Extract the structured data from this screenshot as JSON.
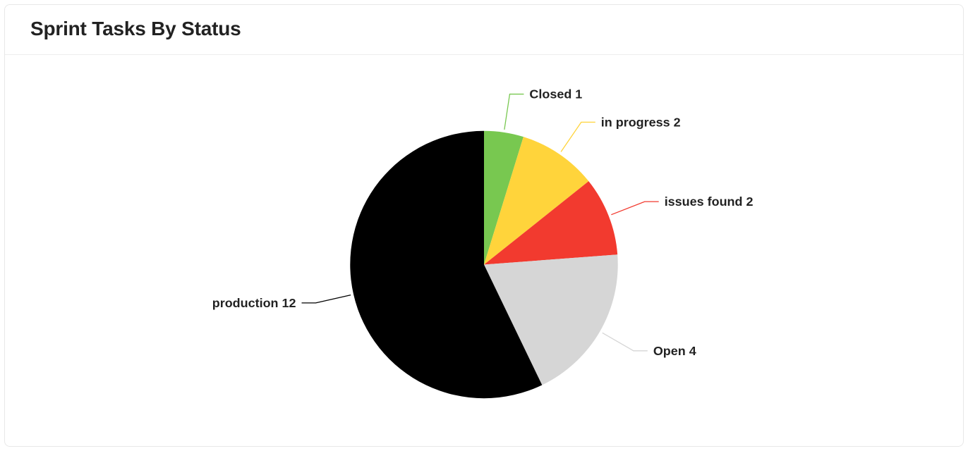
{
  "card": {
    "title": "Sprint Tasks By Status"
  },
  "chart_data": {
    "type": "pie",
    "title": "Sprint Tasks By Status",
    "series": [
      {
        "name": "Closed",
        "value": 1,
        "color": "#78C850"
      },
      {
        "name": "in progress",
        "value": 2,
        "color": "#FFD43B"
      },
      {
        "name": "issues found",
        "value": 2,
        "color": "#F23A2F"
      },
      {
        "name": "Open",
        "value": 4,
        "color": "#D6D6D6"
      },
      {
        "name": "production",
        "value": 12,
        "color": "#000000"
      }
    ]
  }
}
